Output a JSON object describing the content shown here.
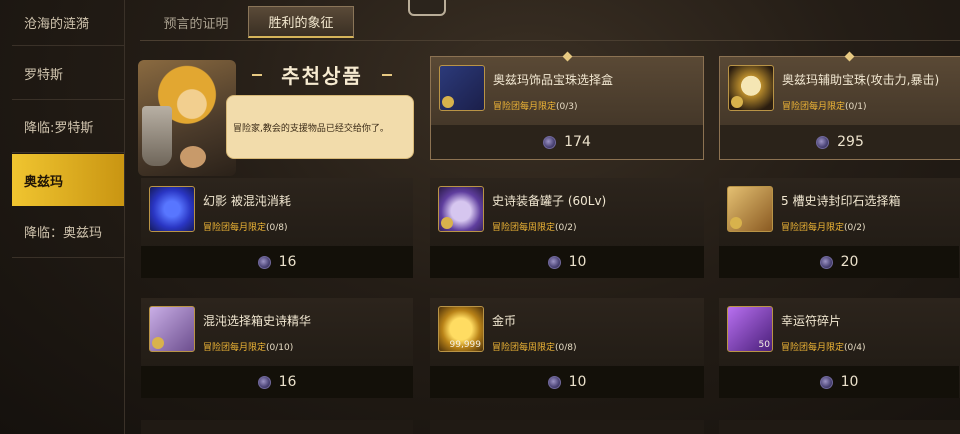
{
  "sidebar": {
    "items": [
      {
        "label": "沧海的涟漪",
        "active": false
      },
      {
        "label": "罗特斯",
        "active": false
      },
      {
        "label": "降临:罗特斯",
        "active": false
      },
      {
        "label": "奥兹玛",
        "active": true
      },
      {
        "label": "降临：奥兹玛",
        "active": false
      }
    ]
  },
  "tabs": [
    {
      "label": "预言的证明",
      "active": false
    },
    {
      "label": "胜利的象征",
      "active": true
    }
  ],
  "recommend": {
    "title": "추천상품",
    "message": "冒险家,教会的支援物品已经交给你了。"
  },
  "currency_icon": "chaos-coin-icon",
  "colors": {
    "accent": "#f0c530",
    "limit_text": "#f0b636",
    "panel": "#2c241c"
  },
  "products": [
    {
      "name": "奥兹玛饰品宝珠选择盒",
      "limit_label": "冒险团每月限定",
      "limit_count": "(0/3)",
      "price": "174",
      "icon": "pendant-icon",
      "featured": true
    },
    {
      "name": "奥兹玛辅助宝珠(攻击力,暴击)",
      "limit_label": "冒险团每月限定",
      "limit_count": "(0/1)",
      "price": "295",
      "icon": "orb-icon",
      "featured": true
    },
    {
      "name": "幻影 被混沌消耗",
      "limit_label": "冒险团每月限定",
      "limit_count": "(0/8)",
      "price": "16",
      "icon": "chaos-mask-icon",
      "featured": false
    },
    {
      "name": "史诗装备罐子 (60Lv)",
      "limit_label": "冒险团每周限定",
      "limit_count": "(0/2)",
      "price": "10",
      "icon": "jar-icon",
      "featured": false
    },
    {
      "name": "5 槽史诗封印石选择箱",
      "limit_label": "冒险团每月限定",
      "limit_count": "(0/2)",
      "price": "20",
      "icon": "seal-box-icon",
      "featured": false
    },
    {
      "name": "混沌选择箱史诗精华",
      "limit_label": "冒险团每月限定",
      "limit_count": "(0/10)",
      "price": "16",
      "icon": "chest-icon",
      "featured": false
    },
    {
      "name": "金币",
      "limit_label": "冒险团每周限定",
      "limit_count": "(0/8)",
      "price": "10",
      "icon": "gold-coins-icon",
      "qty": "99,999",
      "featured": false
    },
    {
      "name": "幸运符碎片",
      "limit_label": "冒险团每月限定",
      "limit_count": "(0/4)",
      "price": "10",
      "icon": "lucky-charm-icon",
      "qty": "50",
      "featured": false
    }
  ]
}
